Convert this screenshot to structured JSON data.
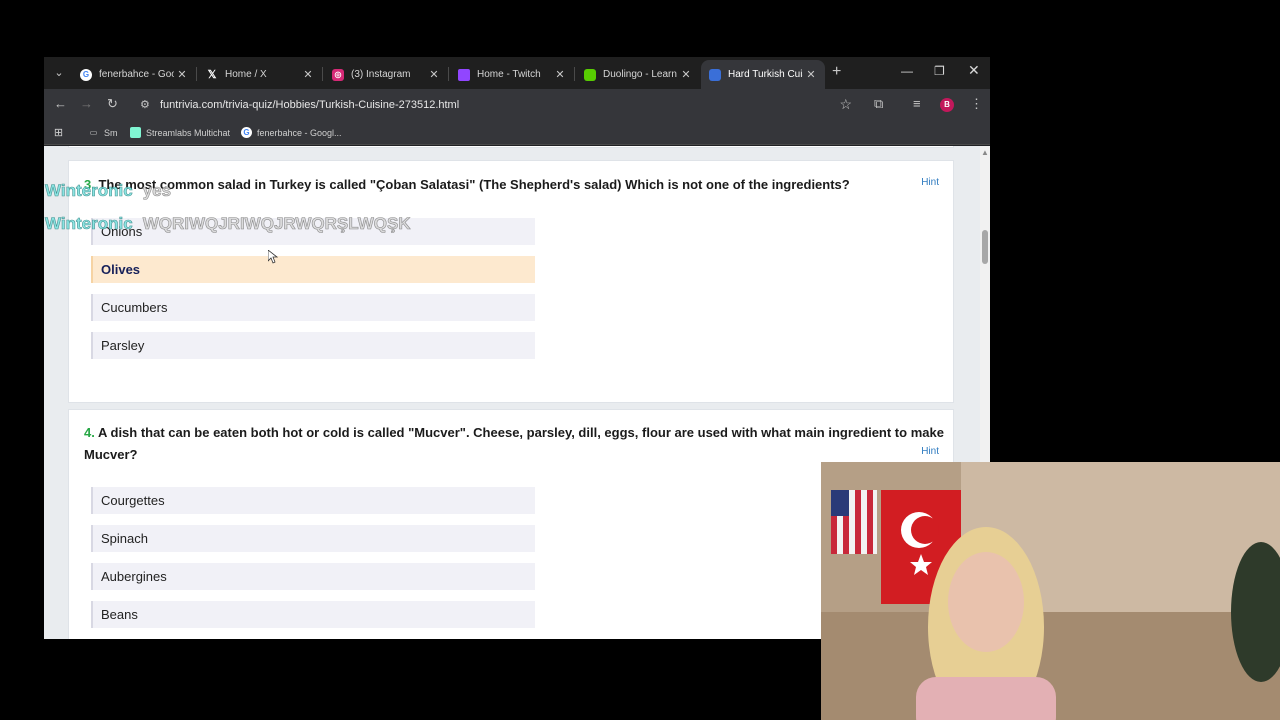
{
  "browser": {
    "tabs": [
      {
        "title": "fenerbahce - Goog",
        "icon": "google-icon",
        "active": false
      },
      {
        "title": "Home / X",
        "icon": "x-icon",
        "active": false
      },
      {
        "title": "(3) Instagram",
        "icon": "instagram-icon",
        "active": false
      },
      {
        "title": "Home - Twitch",
        "icon": "twitch-icon",
        "active": false
      },
      {
        "title": "Duolingo - Learn",
        "icon": "duolingo-icon",
        "active": false
      },
      {
        "title": "Hard Turkish Cuisi",
        "icon": "funtrivia-icon",
        "active": true
      }
    ],
    "url": "funtrivia.com/trivia-quiz/Hobbies/Turkish-Cuisine-273512.html",
    "avatar_letter": "B",
    "bookmarks": [
      {
        "label": "Sm",
        "icon": "folder-icon"
      },
      {
        "label": "Streamlabs Multichat",
        "icon": "streamlabs-icon"
      },
      {
        "label": "fenerbahce - Googl...",
        "icon": "google-icon"
      }
    ]
  },
  "quiz": {
    "q3": {
      "number": "3.",
      "text": "The most common salad in Turkey is called \"Çoban Salatasi\" (The Shepherd's salad) Which is not one of the ingredients?",
      "hint": "Hint",
      "options": [
        "Onions",
        "Olives",
        "Cucumbers",
        "Parsley"
      ],
      "selected": "Olives"
    },
    "q4": {
      "number": "4.",
      "text": "A dish that can be eaten both hot or cold is called \"Mucver\". Cheese, parsley, dill, eggs, flour are used with what main ingredient to make Mucver?",
      "hint": "Hint",
      "options": [
        "Courgettes",
        "Spinach",
        "Aubergines",
        "Beans"
      ]
    }
  },
  "overlay": {
    "chat": [
      {
        "user": "Winteronic",
        "message": "yes"
      },
      {
        "user": "Winteronic",
        "message": "WQRIWQJRIWQJRWQRŞLWQŞK"
      }
    ]
  },
  "colors": {
    "accent_green": "#27a745",
    "selected_bg": "#fde9cf",
    "hint_blue": "#2f7bc0"
  }
}
